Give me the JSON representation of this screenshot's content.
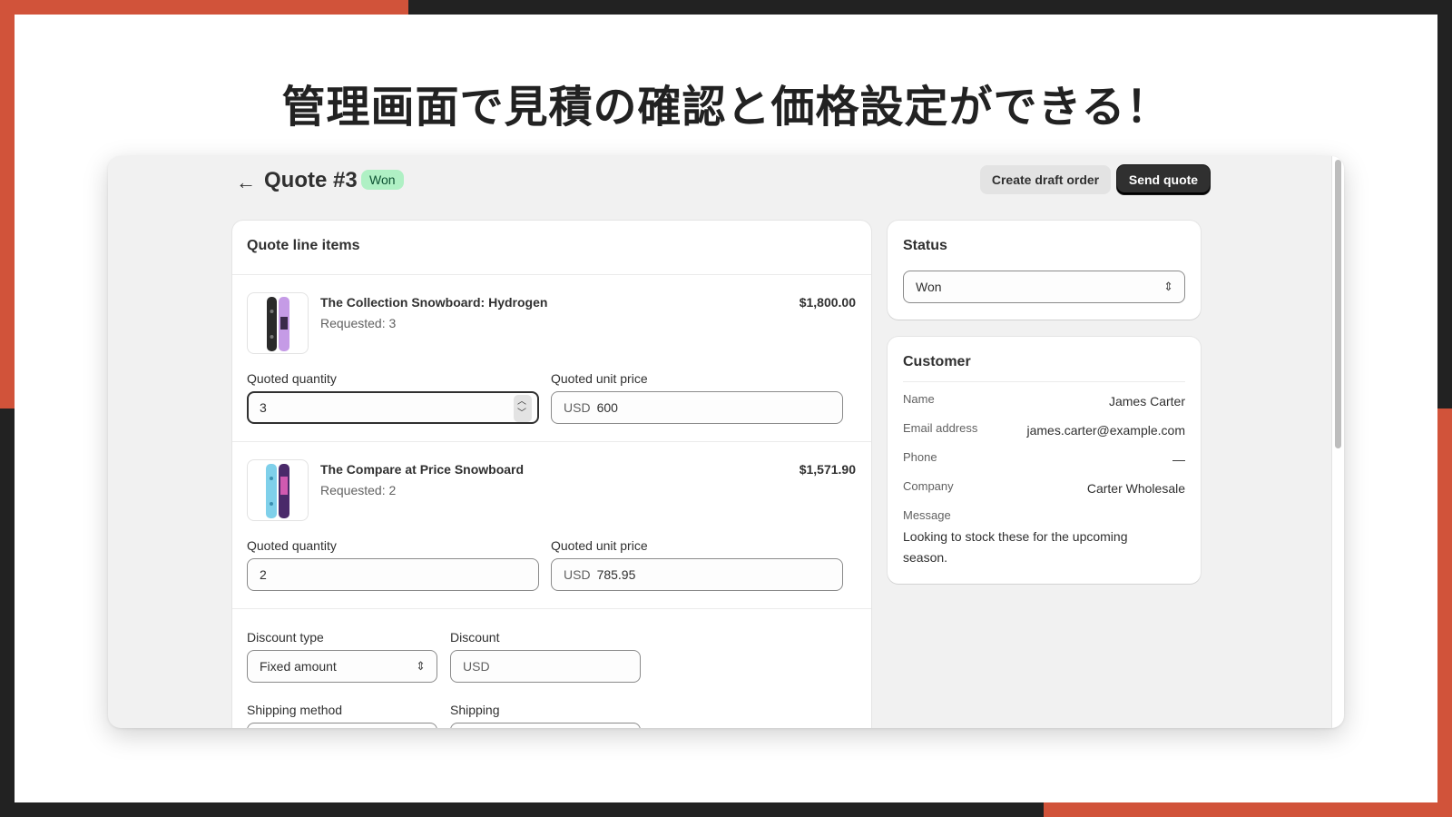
{
  "headline": "管理画面で見積の確認と価格設定ができる！",
  "header": {
    "back_icon": "arrow-left-icon",
    "title": "Quote #3",
    "badge": "Won",
    "create_draft_label": "Create draft order",
    "send_quote_label": "Send quote"
  },
  "line_items": {
    "title": "Quote line items",
    "quantity_label": "Quoted quantity",
    "price_label": "Quoted unit price",
    "currency_prefix": "USD",
    "items": [
      {
        "name": "The Collection Snowboard: Hydrogen",
        "requested": "Requested: 3",
        "total": "$1,800.00",
        "quantity": "3",
        "unit_price": "600"
      },
      {
        "name": "The Compare at Price Snowboard",
        "requested": "Requested: 2",
        "total": "$1,571.90",
        "quantity": "2",
        "unit_price": "785.95"
      }
    ],
    "discount_type_label": "Discount type",
    "discount_type_value": "Fixed amount",
    "discount_label": "Discount",
    "discount_placeholder": "USD",
    "shipping_method_label": "Shipping method",
    "shipping_label": "Shipping"
  },
  "status_card": {
    "title": "Status",
    "selected": "Won"
  },
  "customer": {
    "title": "Customer",
    "name_label": "Name",
    "name": "James Carter",
    "email_label": "Email address",
    "email": "james.carter@example.com",
    "phone_label": "Phone",
    "phone": "—",
    "company_label": "Company",
    "company": "Carter Wholesale",
    "message_label": "Message",
    "message": "Looking to stock these for the upcoming season."
  },
  "colors": {
    "accent_orange": "#d1533a",
    "frame_dark": "#222222",
    "badge_green": "#aff0c4",
    "primary_button": "#303030"
  }
}
